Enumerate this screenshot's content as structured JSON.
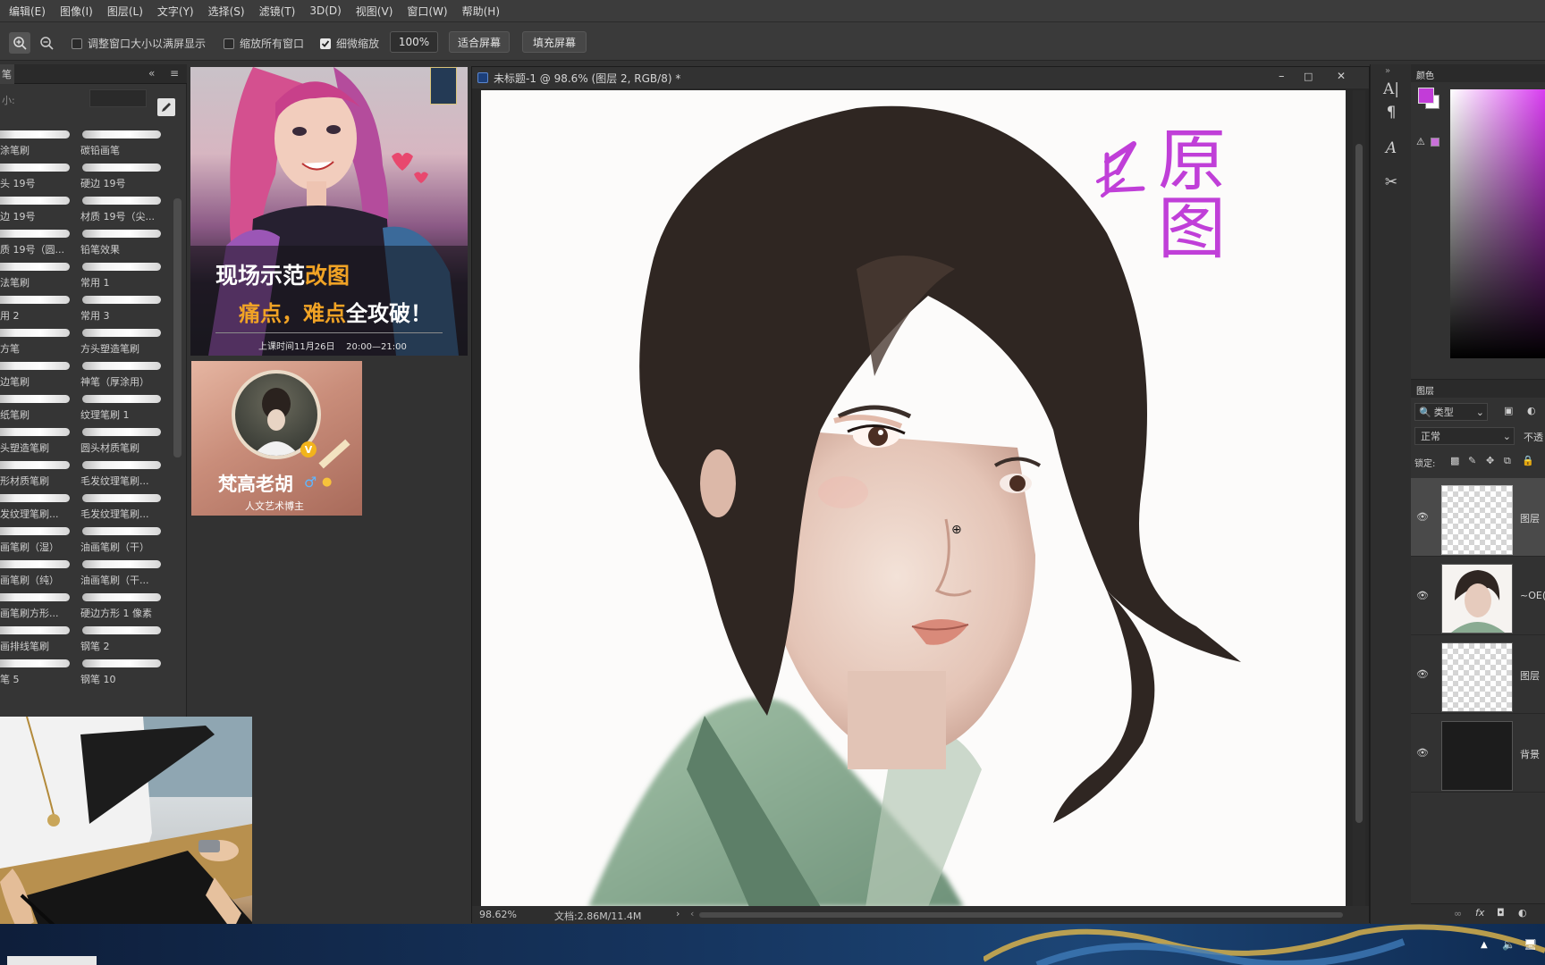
{
  "menubar": {
    "items": [
      "编辑(E)",
      "图像(I)",
      "图层(L)",
      "文字(Y)",
      "选择(S)",
      "滤镜(T)",
      "3D(D)",
      "视图(V)",
      "窗口(W)",
      "帮助(H)"
    ]
  },
  "options": {
    "resize_windows": "调整窗口大小以满屏显示",
    "zoom_all_windows": "缩放所有窗口",
    "scrubby_zoom": "细微缩放",
    "zoom_value": "100%",
    "fit_screen": "适合屏幕",
    "fill_screen": "填充屏幕"
  },
  "brushes": {
    "size_label": "小:",
    "items": [
      {
        "label": "涂笔刷"
      },
      {
        "label": "碳铅画笔"
      },
      {
        "label": "头 19号"
      },
      {
        "label": "硬边 19号"
      },
      {
        "label": "边 19号"
      },
      {
        "label": "材质 19号（尖..."
      },
      {
        "label": "质 19号（圆..."
      },
      {
        "label": "铅笔效果"
      },
      {
        "label": "法笔刷"
      },
      {
        "label": "常用 1"
      },
      {
        "label": "用 2"
      },
      {
        "label": "常用 3"
      },
      {
        "label": "方笔"
      },
      {
        "label": "方头塑造笔刷"
      },
      {
        "label": "边笔刷"
      },
      {
        "label": "神笔（厚涂用）"
      },
      {
        "label": "纸笔刷"
      },
      {
        "label": "纹理笔刷 1"
      },
      {
        "label": "头塑造笔刷"
      },
      {
        "label": "圆头材质笔刷"
      },
      {
        "label": "形材质笔刷"
      },
      {
        "label": "毛发纹理笔刷..."
      },
      {
        "label": "发纹理笔刷..."
      },
      {
        "label": "毛发纹理笔刷..."
      },
      {
        "label": "画笔刷（湿）"
      },
      {
        "label": "油画笔刷（干）"
      },
      {
        "label": "画笔刷（纯）"
      },
      {
        "label": "油画笔刷（干..."
      },
      {
        "label": "画笔刷方形..."
      },
      {
        "label": "硬边方形 1 像素"
      },
      {
        "label": "画排线笔刷"
      },
      {
        "label": "钢笔 2"
      },
      {
        "label": "笔 5"
      },
      {
        "label": "钢笔 10"
      }
    ]
  },
  "poster": {
    "line1a": "现场示范",
    "line1b": "改图",
    "line2a": "痛点，难点",
    "line2b": "全攻破！",
    "schedule": "上课时间11月26日    20:00—21:00"
  },
  "teacher": {
    "name": "梵高老胡",
    "subtitle": "人文艺术博主"
  },
  "document": {
    "title": "未标题-1 @ 98.6% (图层 2, RGB/8) *",
    "zoom": "98.62%",
    "doc_size": "文档:2.86M/11.4M",
    "annotation": "原图"
  },
  "colors": {
    "label": "颜色",
    "foreground": "#c23cd8",
    "background": "#ffffff"
  },
  "layers": {
    "label": "图层",
    "filter": "类型",
    "blend_mode": "正常",
    "opacity_label": "不透",
    "lock_label": "锁定:",
    "items": [
      {
        "name": "图层"
      },
      {
        "name": "~OE("
      },
      {
        "name": "图层"
      },
      {
        "name": "背景"
      }
    ]
  }
}
